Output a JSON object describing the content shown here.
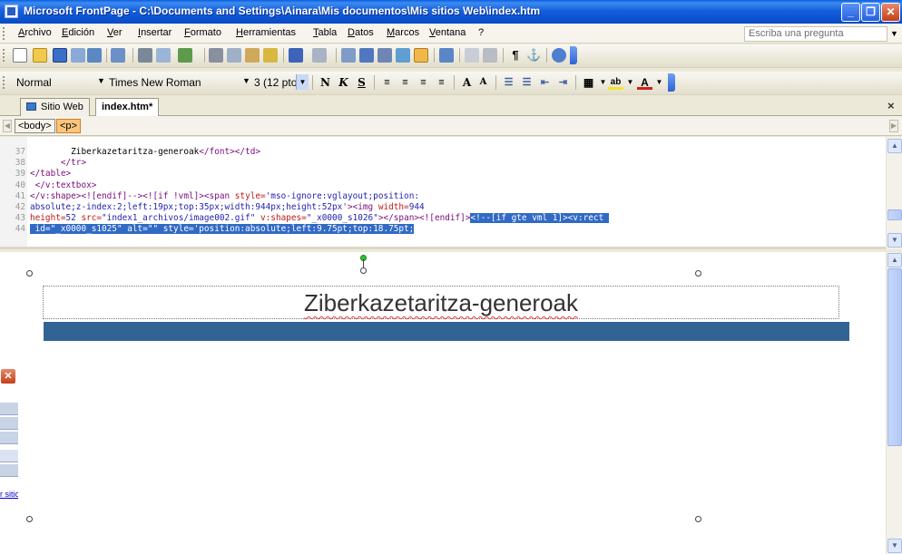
{
  "window": {
    "title": "Microsoft FrontPage - C:\\Documents and Settings\\Ainara\\Mis documentos\\Mis sitios Web\\index.htm",
    "buttons": [
      "_",
      "❐",
      "✕"
    ]
  },
  "menu": {
    "items": [
      "Archivo",
      "Edición",
      "Ver",
      "Insertar",
      "Formato",
      "Herramientas",
      "Tabla",
      "Datos",
      "Marcos",
      "Ventana",
      "?"
    ],
    "ask_placeholder": "Escriba una pregunta"
  },
  "format_toolbar": {
    "style": "Normal",
    "font": "Times New Roman",
    "size": "3  (12 pto)",
    "bold": "N",
    "italic": "K",
    "underline": "S"
  },
  "tabs": {
    "site": "Sitio Web",
    "file": "index.htm*",
    "close": "×"
  },
  "quicktags": [
    "<body>",
    "<p>"
  ],
  "code": {
    "lines": [
      {
        "n": "37",
        "parts": [
          {
            "t": "        Ziberkazetaritza-generoak",
            "c": ""
          },
          {
            "t": "</font></td>",
            "c": "tagc"
          }
        ]
      },
      {
        "n": "38",
        "parts": [
          {
            "t": "      ",
            "c": ""
          },
          {
            "t": "</tr>",
            "c": "tagc"
          }
        ]
      },
      {
        "n": "39",
        "parts": [
          {
            "t": "</table>",
            "c": "tagc"
          }
        ]
      },
      {
        "n": "40",
        "parts": [
          {
            "t": " </v:textbox>",
            "c": "tagc"
          }
        ]
      },
      {
        "n": "41",
        "parts": [
          {
            "t": "</v:shape><![endif]--><![if !vml]><span ",
            "c": "tagc"
          },
          {
            "t": "style=",
            "c": "attrc"
          },
          {
            "t": "'mso-ignore:vglayout;position:",
            "c": "valc"
          }
        ]
      },
      {
        "n": "42",
        "parts": [
          {
            "t": "absolute;z-index:2;left:19px;top:35px;width:944px;height:52px'",
            "c": "valc"
          },
          {
            "t": "><img ",
            "c": "tagc"
          },
          {
            "t": "width=",
            "c": "attrc"
          },
          {
            "t": "944",
            "c": "valc"
          }
        ]
      },
      {
        "n": "43",
        "parts": [
          {
            "t": "height=",
            "c": "attrc"
          },
          {
            "t": "52 ",
            "c": "valc"
          },
          {
            "t": "src=",
            "c": "attrc"
          },
          {
            "t": "\"index1_archivos/image002.gif\" ",
            "c": "valc"
          },
          {
            "t": "v:shapes=",
            "c": "attrc"
          },
          {
            "t": "\"_x0000_s1026\"",
            "c": "valc"
          },
          {
            "t": "></span><![endif]>",
            "c": "tagc"
          },
          {
            "t": "<!--[if gte vml 1]><v:rect ",
            "c": "selc"
          }
        ]
      },
      {
        "n": "44",
        "parts": [
          {
            "t": " id=\"_x0000_s1025\" alt=\"\" style='position:absolute;left:9.75pt;top:18.75pt;",
            "c": "selc"
          }
        ]
      }
    ]
  },
  "design": {
    "headline": "Ziberkazetaritza-generoak",
    "bar_color": "#316395"
  },
  "side_panel": {
    "link": "r sitio"
  },
  "colors": {
    "title_bar": "#0b52d0",
    "selection": "#316ac5",
    "quicktag_selected": "#fbc57c"
  }
}
